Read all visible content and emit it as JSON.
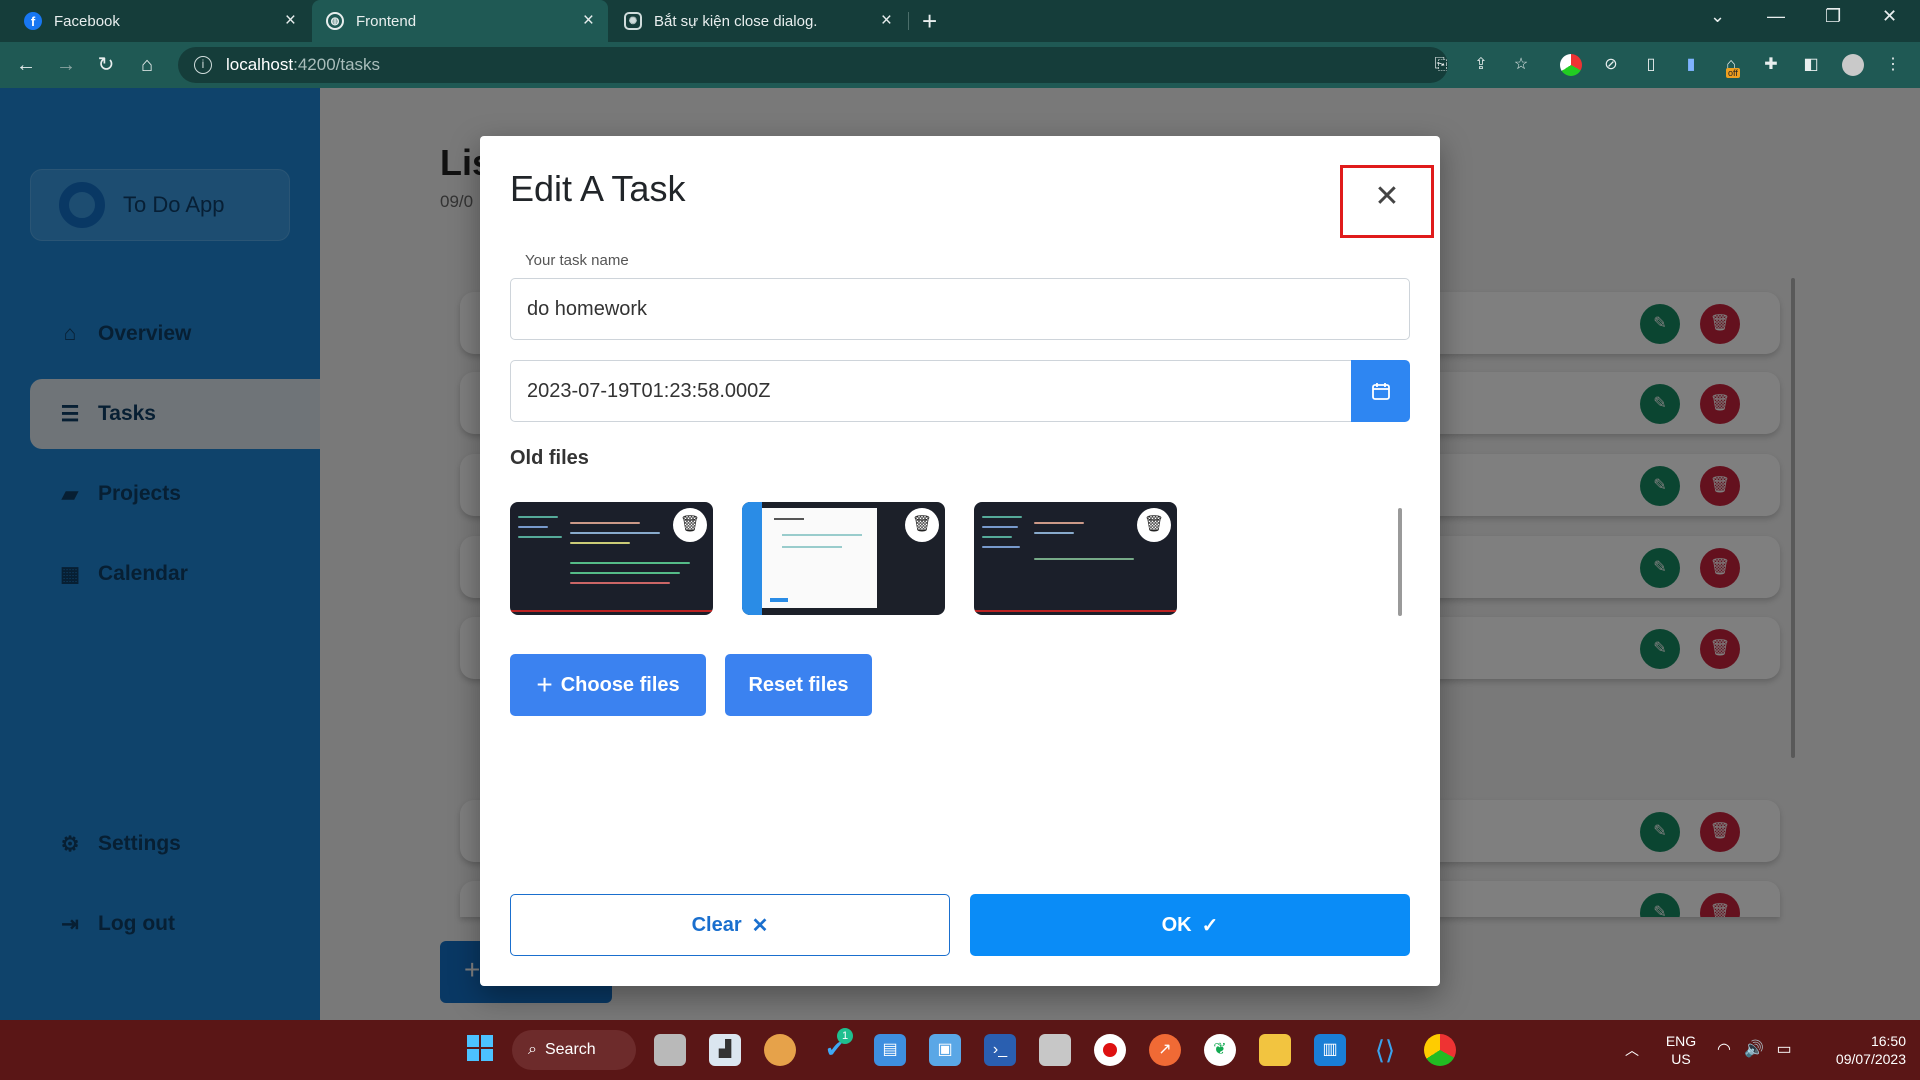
{
  "browser": {
    "tabs": [
      {
        "title": "Facebook",
        "favicon": "facebook-icon"
      },
      {
        "title": "Frontend",
        "favicon": "globe-icon"
      },
      {
        "title": "Bắt sự kiện close dialog.",
        "favicon": "chatgpt-icon"
      }
    ],
    "tab_close": "×",
    "new_tab": "+",
    "url_host": "localhost",
    "url_path": ":4200/tasks"
  },
  "app": {
    "brand": "To Do App",
    "nav": [
      {
        "label": "Overview",
        "icon": "home-icon"
      },
      {
        "label": "Tasks",
        "icon": "list-check-icon"
      },
      {
        "label": "Projects",
        "icon": "folder-icon"
      },
      {
        "label": "Calendar",
        "icon": "calendar-icon"
      },
      {
        "label": "Settings",
        "icon": "gear-icon"
      },
      {
        "label": "Log out",
        "icon": "logout-icon"
      }
    ],
    "page_title_partial": "Lis",
    "page_date_partial": "09/0",
    "add_button": "+"
  },
  "dialog": {
    "title": "Edit A Task",
    "task_name_label": "Your task name",
    "task_name_value": "do homework",
    "date_value": "2023-07-19T01:23:58.000Z",
    "old_files_heading": "Old files",
    "choose_files_label": "Choose files",
    "reset_files_label": "Reset files",
    "clear_label": "Clear",
    "ok_label": "OK"
  },
  "taskbar": {
    "search_label": "Search",
    "lang_line1": "ENG",
    "lang_line2": "US",
    "time": "16:50",
    "date": "09/07/2023",
    "badge_count": "1",
    "ext_off_label": "off"
  },
  "colors": {
    "sidebar": "#1f87d6",
    "primary": "#3b82f0",
    "ok": "#0a8cf7",
    "edit": "#168a62",
    "delete": "#c9223d",
    "highlight": "#e01b1b"
  }
}
